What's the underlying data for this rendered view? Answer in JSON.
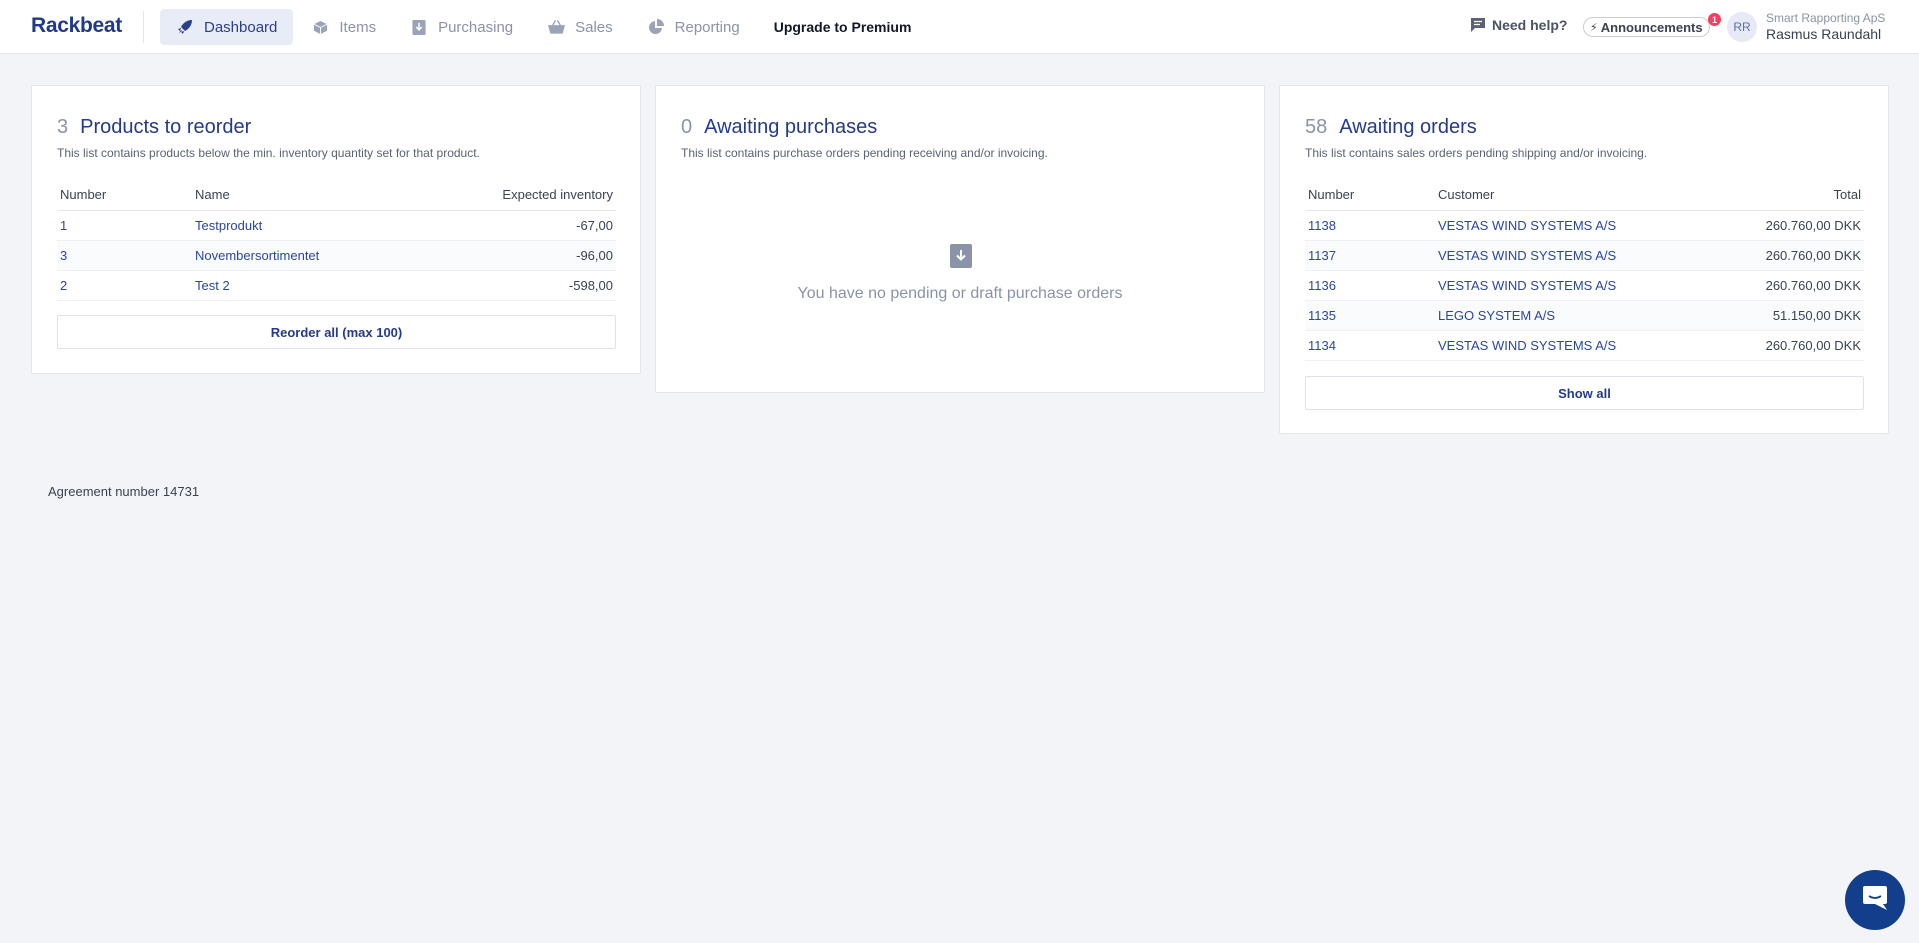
{
  "app": {
    "logo": "Rackbeat"
  },
  "nav": {
    "items": [
      {
        "label": "Dashboard",
        "icon": "rocket-icon",
        "active": true
      },
      {
        "label": "Items",
        "icon": "box-icon"
      },
      {
        "label": "Purchasing",
        "icon": "download-icon"
      },
      {
        "label": "Sales",
        "icon": "basket-icon"
      },
      {
        "label": "Reporting",
        "icon": "pie-chart-icon"
      }
    ],
    "premium_label": "Upgrade to Premium"
  },
  "header": {
    "help_label": "Need help?",
    "announcements_label": "Announcements",
    "announcements_badge": "1",
    "avatar_initials": "RR",
    "company": "Smart Rapporting ApS",
    "user_name": "Rasmus Raundahl"
  },
  "reorder": {
    "count": "3",
    "title": "Products to reorder",
    "description": "This list contains products below the min. inventory quantity set for that product.",
    "columns": [
      "Number",
      "Name",
      "Expected inventory"
    ],
    "rows": [
      {
        "number": "1",
        "name": "Testprodukt",
        "expected": "-67,00"
      },
      {
        "number": "3",
        "name": "Novembersortimentet",
        "expected": "-96,00"
      },
      {
        "number": "2",
        "name": "Test 2",
        "expected": "-598,00"
      }
    ],
    "button_label": "Reorder all (max 100)"
  },
  "purchases": {
    "count": "0",
    "title": "Awaiting purchases",
    "description": "This list contains purchase orders pending receiving and/or invoicing.",
    "empty_text": "You have no pending or draft purchase orders"
  },
  "orders": {
    "count": "58",
    "title": "Awaiting orders",
    "description": "This list contains sales orders pending shipping and/or invoicing.",
    "columns": [
      "Number",
      "Customer",
      "Total"
    ],
    "rows": [
      {
        "number": "1138",
        "customer": "VESTAS WIND SYSTEMS A/S",
        "total": "260.760,00 DKK"
      },
      {
        "number": "1137",
        "customer": "VESTAS WIND SYSTEMS A/S",
        "total": "260.760,00 DKK"
      },
      {
        "number": "1136",
        "customer": "VESTAS WIND SYSTEMS A/S",
        "total": "260.760,00 DKK"
      },
      {
        "number": "1135",
        "customer": "LEGO SYSTEM A/S",
        "total": "51.150,00 DKK"
      },
      {
        "number": "1134",
        "customer": "VESTAS WIND SYSTEMS A/S",
        "total": "260.760,00 DKK"
      }
    ],
    "button_label": "Show all"
  },
  "footer": {
    "agreement": "Agreement number 14731"
  }
}
